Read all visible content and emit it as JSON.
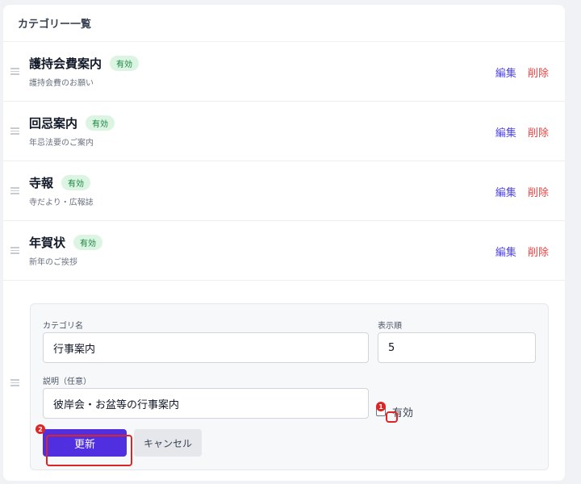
{
  "header": {
    "title": "カテゴリー一覧"
  },
  "categories": [
    {
      "name": "護持会費案内",
      "status": "有効",
      "description": "護持会費のお願い",
      "edit_label": "編集",
      "delete_label": "削除"
    },
    {
      "name": "回忌案内",
      "status": "有効",
      "description": "年忌法要のご案内",
      "edit_label": "編集",
      "delete_label": "削除"
    },
    {
      "name": "寺報",
      "status": "有効",
      "description": "寺だより・広報誌",
      "edit_label": "編集",
      "delete_label": "削除"
    },
    {
      "name": "年賀状",
      "status": "有効",
      "description": "新年のご挨拶",
      "edit_label": "編集",
      "delete_label": "削除"
    }
  ],
  "edit_form": {
    "name_label": "カテゴリ名",
    "name_value": "行事案内",
    "order_label": "表示順",
    "order_value": "5",
    "description_label": "説明（任意）",
    "description_value": "彼岸会・お盆等の行事案内",
    "active_label": "有効",
    "active_checked": false,
    "update_label": "更新",
    "cancel_label": "キャンセル"
  },
  "annotations": {
    "marker_1": "1",
    "marker_2": "2"
  },
  "colors": {
    "primary": "#4f2fe0",
    "danger": "#ef4444",
    "badge_bg": "#dcf5e3",
    "badge_text": "#15803d",
    "annotation": "#dc2626"
  }
}
